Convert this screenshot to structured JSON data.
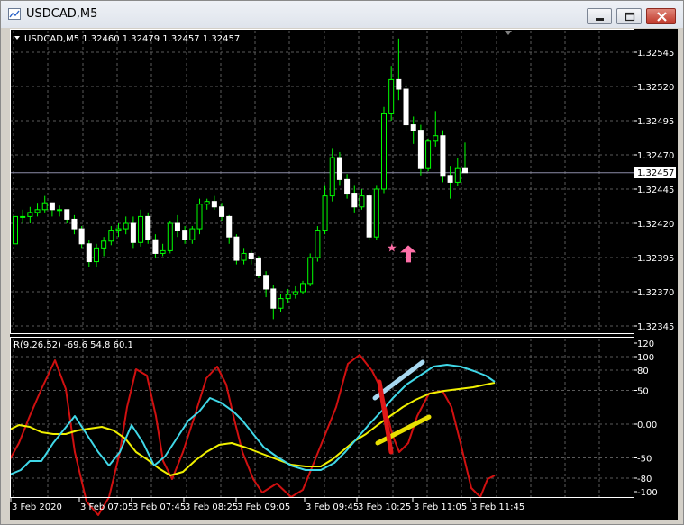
{
  "window": {
    "title": "USDCAD,M5",
    "buttons": [
      "minimize-icon",
      "maximize-icon",
      "close-icon"
    ]
  },
  "chart_header": {
    "symbol_info": "USDCAD,M5  1.32460 1.32479 1.32457 1.32457"
  },
  "price_axis": {
    "labels": [
      "1.32545",
      "1.32520",
      "1.32495",
      "1.32470",
      "1.32445",
      "1.32420",
      "1.32395",
      "1.32370",
      "1.32345"
    ],
    "current_price": "1.32457"
  },
  "indicator": {
    "label": "R(9,26,52) -69.6 54.8 60.1",
    "axis_labels": [
      "120",
      "100",
      "80",
      "50",
      "0.00",
      "-50",
      "-80",
      "-100"
    ]
  },
  "time_axis": {
    "labels": [
      "3 Feb 2020",
      "3 Feb 07:05",
      "3 Feb 07:45",
      "3 Feb 08:25",
      "3 Feb 09:05",
      "3 Feb 09:45",
      "3 Feb 10:25",
      "3 Feb 11:05",
      "3 Feb 11:45"
    ]
  },
  "colors": {
    "background": "#000000",
    "grid": "#5a5a5a",
    "candle": "#00ff00",
    "indicator_red": "#d01010",
    "indicator_cyan": "#40d8e8",
    "indicator_yellow": "#f0f000",
    "marker": "#ff6fa8"
  },
  "chart_data": {
    "type": "candlestick",
    "symbol": "USDCAD",
    "timeframe": "M5",
    "current": {
      "open": 1.3246,
      "high": 1.32479,
      "low": 1.32457,
      "close": 1.32457
    },
    "price_range": [
      1.32345,
      1.32545
    ],
    "candles": [
      [
        1.32405,
        1.32425,
        1.32405,
        1.32425
      ],
      [
        1.32425,
        1.3243,
        1.3242,
        1.32425
      ],
      [
        1.32425,
        1.32432,
        1.3242,
        1.32428
      ],
      [
        1.32428,
        1.32435,
        1.32425,
        1.3243
      ],
      [
        1.3243,
        1.3244,
        1.32428,
        1.32435
      ],
      [
        1.32435,
        1.32435,
        1.32425,
        1.3243
      ],
      [
        1.3243,
        1.32433,
        1.32425,
        1.3243
      ],
      [
        1.3243,
        1.3243,
        1.3242,
        1.32423
      ],
      [
        1.32423,
        1.32426,
        1.32412,
        1.32416
      ],
      [
        1.32416,
        1.32418,
        1.32402,
        1.32405
      ],
      [
        1.32405,
        1.32408,
        1.32388,
        1.32392
      ],
      [
        1.32392,
        1.32405,
        1.32388,
        1.32402
      ],
      [
        1.32402,
        1.3241,
        1.32396,
        1.32407
      ],
      [
        1.32407,
        1.32418,
        1.32404,
        1.32415
      ],
      [
        1.32415,
        1.3242,
        1.3241,
        1.32416
      ],
      [
        1.32416,
        1.32425,
        1.32412,
        1.3242
      ],
      [
        1.3242,
        1.32425,
        1.32402,
        1.32406
      ],
      [
        1.32406,
        1.3243,
        1.32403,
        1.32425
      ],
      [
        1.32425,
        1.32428,
        1.32405,
        1.32408
      ],
      [
        1.32408,
        1.32412,
        1.32395,
        1.32398
      ],
      [
        1.32398,
        1.32405,
        1.32396,
        1.324
      ],
      [
        1.324,
        1.32422,
        1.32398,
        1.3242
      ],
      [
        1.3242,
        1.32426,
        1.3241,
        1.32415
      ],
      [
        1.32415,
        1.32418,
        1.32405,
        1.32408
      ],
      [
        1.32408,
        1.32418,
        1.32405,
        1.32416
      ],
      [
        1.32416,
        1.32438,
        1.32412,
        1.32434
      ],
      [
        1.32434,
        1.32438,
        1.3243,
        1.32436
      ],
      [
        1.32436,
        1.3244,
        1.3243,
        1.32432
      ],
      [
        1.32432,
        1.32435,
        1.32422,
        1.32425
      ],
      [
        1.32425,
        1.32426,
        1.32405,
        1.3241
      ],
      [
        1.3241,
        1.32412,
        1.3239,
        1.32393
      ],
      [
        1.32393,
        1.32402,
        1.3239,
        1.32398
      ],
      [
        1.32398,
        1.324,
        1.3239,
        1.32394
      ],
      [
        1.32394,
        1.32396,
        1.3238,
        1.32382
      ],
      [
        1.32382,
        1.32385,
        1.32366,
        1.32372
      ],
      [
        1.32372,
        1.32375,
        1.3235,
        1.32358
      ],
      [
        1.32358,
        1.32368,
        1.32355,
        1.32365
      ],
      [
        1.32365,
        1.32372,
        1.32362,
        1.32368
      ],
      [
        1.32368,
        1.32374,
        1.32365,
        1.3237
      ],
      [
        1.3237,
        1.32378,
        1.32368,
        1.32376
      ],
      [
        1.32376,
        1.32398,
        1.32374,
        1.32395
      ],
      [
        1.32395,
        1.32418,
        1.32392,
        1.32415
      ],
      [
        1.32415,
        1.32448,
        1.32412,
        1.3244
      ],
      [
        1.3244,
        1.32475,
        1.32436,
        1.32468
      ],
      [
        1.32468,
        1.32472,
        1.32448,
        1.32452
      ],
      [
        1.32452,
        1.32456,
        1.32438,
        1.32442
      ],
      [
        1.32442,
        1.32448,
        1.32428,
        1.32432
      ],
      [
        1.32432,
        1.32445,
        1.3243,
        1.3244
      ],
      [
        1.3244,
        1.32442,
        1.32408,
        1.3241
      ],
      [
        1.3241,
        1.32448,
        1.32408,
        1.32445
      ],
      [
        1.32445,
        1.32505,
        1.32442,
        1.325
      ],
      [
        1.325,
        1.32535,
        1.32495,
        1.32525
      ],
      [
        1.32525,
        1.32555,
        1.3251,
        1.32518
      ],
      [
        1.32518,
        1.32522,
        1.32488,
        1.32492
      ],
      [
        1.32492,
        1.32498,
        1.32478,
        1.32488
      ],
      [
        1.32488,
        1.32492,
        1.32455,
        1.3246
      ],
      [
        1.3246,
        1.32482,
        1.32458,
        1.3248
      ],
      [
        1.3248,
        1.32502,
        1.32476,
        1.32484
      ],
      [
        1.32484,
        1.32488,
        1.3245,
        1.32455
      ],
      [
        1.32455,
        1.32462,
        1.32438,
        1.3245
      ],
      [
        1.3245,
        1.32468,
        1.32447,
        1.3246
      ],
      [
        1.3246,
        1.32479,
        1.32457,
        1.32457
      ]
    ],
    "signal_marker": {
      "type": "buy-arrow",
      "price": 1.324
    }
  }
}
